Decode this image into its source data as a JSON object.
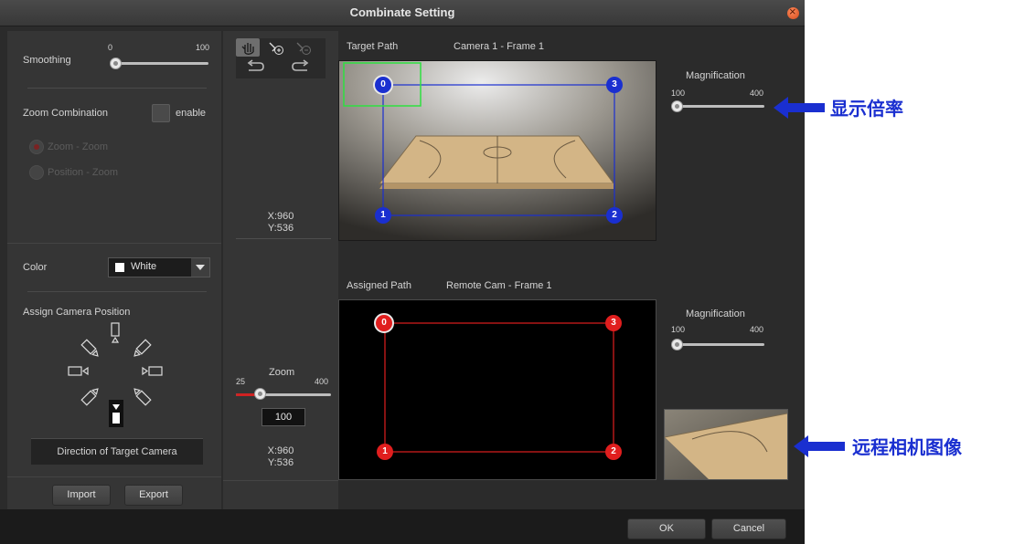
{
  "window": {
    "title": "Combinate Setting"
  },
  "left": {
    "smoothing": {
      "label": "Smoothing",
      "min": "0",
      "max": "100",
      "value": 0
    },
    "zoom_combination": {
      "label": "Zoom Combination",
      "enable_label": "enable",
      "enabled": false
    },
    "zoom_modes": [
      {
        "label": "Zoom - Zoom",
        "selected": true
      },
      {
        "label": "Position - Zoom",
        "selected": false
      }
    ],
    "color": {
      "label": "Color",
      "value": "White",
      "swatch": "#ffffff"
    },
    "assign": {
      "label": "Assign Camera Position",
      "direction_label": "Direction of Target Camera"
    },
    "import_label": "Import",
    "export_label": "Export"
  },
  "middle": {
    "tools": [
      "hand-icon",
      "add-point-icon",
      "remove-point-icon",
      "undo-icon",
      "redo-icon"
    ],
    "target_coords": {
      "x": "X:960",
      "y": "Y:536"
    },
    "zoom": {
      "label": "Zoom",
      "min": "25",
      "max": "400",
      "value": "100"
    },
    "assigned_coords": {
      "x": "X:960",
      "y": "Y:536"
    }
  },
  "target": {
    "title": "Target Path",
    "frame": "Camera 1 - Frame 1",
    "points": [
      "0",
      "1",
      "2",
      "3"
    ],
    "magnification": {
      "label": "Magnification",
      "min": "100",
      "max": "400"
    }
  },
  "assigned": {
    "title": "Assigned Path",
    "frame": "Remote Cam - Frame 1",
    "points": [
      "0",
      "1",
      "2",
      "3"
    ],
    "magnification": {
      "label": "Magnification",
      "min": "100",
      "max": "400"
    }
  },
  "footer": {
    "ok_label": "OK",
    "cancel_label": "Cancel"
  },
  "annotations": {
    "magnification_note": "显示倍率",
    "remote_image_note": "远程相机图像",
    "color": "#1a2fd0"
  }
}
